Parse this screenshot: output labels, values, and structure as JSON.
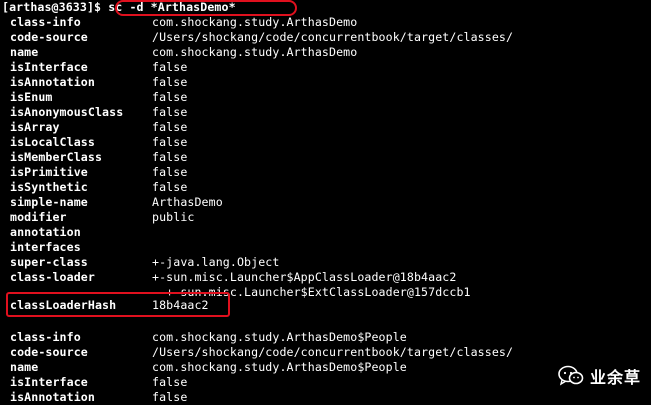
{
  "terminal": {
    "prompt": "[arthas@3633]$ ",
    "command": "sc -d *ArthasDemo*",
    "rows": [
      {
        "key": "class-info",
        "value": "com.shockang.study.ArthasDemo"
      },
      {
        "key": "code-source",
        "value": "/Users/shockang/code/concurrentbook/target/classes/"
      },
      {
        "key": "name",
        "value": "com.shockang.study.ArthasDemo"
      },
      {
        "key": "isInterface",
        "value": "false"
      },
      {
        "key": "isAnnotation",
        "value": "false"
      },
      {
        "key": "isEnum",
        "value": "false"
      },
      {
        "key": "isAnonymousClass",
        "value": "false"
      },
      {
        "key": "isArray",
        "value": "false"
      },
      {
        "key": "isLocalClass",
        "value": "false"
      },
      {
        "key": "isMemberClass",
        "value": "false"
      },
      {
        "key": "isPrimitive",
        "value": "false"
      },
      {
        "key": "isSynthetic",
        "value": "false"
      },
      {
        "key": "simple-name",
        "value": "ArthasDemo"
      },
      {
        "key": "modifier",
        "value": "public"
      },
      {
        "key": "annotation",
        "value": ""
      },
      {
        "key": "interfaces",
        "value": ""
      },
      {
        "key": "super-class",
        "value": "+-java.lang.Object"
      },
      {
        "key": "class-loader",
        "value": "+-sun.misc.Launcher$AppClassLoader@18b4aac2"
      },
      {
        "key": "",
        "value": "  +-sun.misc.Launcher$ExtClassLoader@157dccb1"
      },
      {
        "key": "classLoaderHash",
        "value": "18b4aac2"
      },
      {
        "key": "",
        "value": ""
      },
      {
        "key": "class-info",
        "value": "com.shockang.study.ArthasDemo$People"
      },
      {
        "key": "code-source",
        "value": "/Users/shockang/code/concurrentbook/target/classes/"
      },
      {
        "key": "name",
        "value": "com.shockang.study.ArthasDemo$People"
      },
      {
        "key": "isInterface",
        "value": "false"
      },
      {
        "key": "isAnnotation",
        "value": "false"
      }
    ]
  },
  "watermark": {
    "text": "业余草",
    "icon": "wechat-icon"
  },
  "colors": {
    "background": "#000000",
    "text": "#ffffff",
    "highlight": "#e0101e"
  }
}
